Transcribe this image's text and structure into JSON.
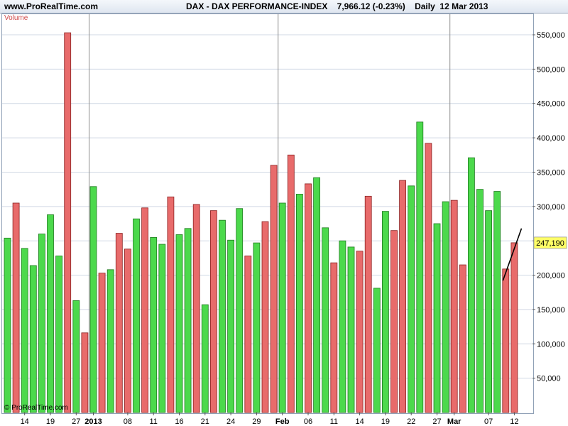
{
  "header": {
    "site": "www.ProRealTime.com",
    "title": "DAX - DAX PERFORMANCE-INDEX    7,966.12 (-0.23%)    Daily  12 Mar 2013"
  },
  "indicator_label": "Volume",
  "copyright": "© ProRealTime.com",
  "current_value_label": "247,190",
  "colors": {
    "up": "#4cd94c",
    "down": "#e86b6b",
    "up_stroke": "#1f7a1f",
    "down_stroke": "#8a2020",
    "grid": "#d0d8e4",
    "axis_bg": "#ffffff",
    "marker_bg": "#ffff66"
  },
  "chart_data": {
    "type": "bar",
    "title": "DAX - DAX PERFORMANCE-INDEX",
    "ylim": [
      0,
      580000
    ],
    "y_ticks": [
      {
        "value": 50000,
        "label": "50,000"
      },
      {
        "value": 100000,
        "label": "100,000"
      },
      {
        "value": 150000,
        "label": "150,000"
      },
      {
        "value": 200000,
        "label": "200,000"
      },
      {
        "value": 250000,
        "label": "250,000"
      },
      {
        "value": 300000,
        "label": "300,000"
      },
      {
        "value": 350000,
        "label": "350,000"
      },
      {
        "value": 400000,
        "label": "400,000"
      },
      {
        "value": 450000,
        "label": "450,000"
      },
      {
        "value": 500000,
        "label": "500,000"
      },
      {
        "value": 550000,
        "label": "550,000"
      }
    ],
    "x_ticks": [
      {
        "index": 2,
        "label": "14",
        "bold": false
      },
      {
        "index": 5,
        "label": "19",
        "bold": false
      },
      {
        "index": 8,
        "label": "27",
        "bold": false
      },
      {
        "index": 10,
        "label": "2013",
        "bold": true,
        "separator": true
      },
      {
        "index": 14,
        "label": "08",
        "bold": false
      },
      {
        "index": 17,
        "label": "11",
        "bold": false
      },
      {
        "index": 20,
        "label": "16",
        "bold": false
      },
      {
        "index": 23,
        "label": "21",
        "bold": false
      },
      {
        "index": 26,
        "label": "24",
        "bold": false
      },
      {
        "index": 29,
        "label": "29",
        "bold": false
      },
      {
        "index": 32,
        "label": "Feb",
        "bold": true,
        "separator": true
      },
      {
        "index": 35,
        "label": "06",
        "bold": false
      },
      {
        "index": 38,
        "label": "11",
        "bold": false
      },
      {
        "index": 41,
        "label": "14",
        "bold": false
      },
      {
        "index": 44,
        "label": "19",
        "bold": false
      },
      {
        "index": 47,
        "label": "22",
        "bold": false
      },
      {
        "index": 50,
        "label": "27",
        "bold": false
      },
      {
        "index": 52,
        "label": "Mar",
        "bold": true,
        "separator": true
      },
      {
        "index": 56,
        "label": "07",
        "bold": false
      },
      {
        "index": 59,
        "label": "12",
        "bold": false
      }
    ],
    "bars": [
      {
        "v": 254000,
        "d": "up"
      },
      {
        "v": 305000,
        "d": "down"
      },
      {
        "v": 239000,
        "d": "up"
      },
      {
        "v": 214000,
        "d": "up"
      },
      {
        "v": 260000,
        "d": "up"
      },
      {
        "v": 288000,
        "d": "up"
      },
      {
        "v": 228000,
        "d": "up"
      },
      {
        "v": 553000,
        "d": "down"
      },
      {
        "v": 163000,
        "d": "up"
      },
      {
        "v": 116000,
        "d": "down"
      },
      {
        "v": 329000,
        "d": "up"
      },
      {
        "v": 203000,
        "d": "down"
      },
      {
        "v": 208000,
        "d": "up"
      },
      {
        "v": 261000,
        "d": "down"
      },
      {
        "v": 238000,
        "d": "down"
      },
      {
        "v": 282000,
        "d": "up"
      },
      {
        "v": 298000,
        "d": "down"
      },
      {
        "v": 255000,
        "d": "up"
      },
      {
        "v": 245000,
        "d": "up"
      },
      {
        "v": 314000,
        "d": "down"
      },
      {
        "v": 259000,
        "d": "up"
      },
      {
        "v": 268000,
        "d": "up"
      },
      {
        "v": 303000,
        "d": "down"
      },
      {
        "v": 157000,
        "d": "up"
      },
      {
        "v": 294000,
        "d": "down"
      },
      {
        "v": 280000,
        "d": "up"
      },
      {
        "v": 251000,
        "d": "up"
      },
      {
        "v": 297000,
        "d": "up"
      },
      {
        "v": 228000,
        "d": "down"
      },
      {
        "v": 247000,
        "d": "up"
      },
      {
        "v": 278000,
        "d": "down"
      },
      {
        "v": 360000,
        "d": "down"
      },
      {
        "v": 305000,
        "d": "up"
      },
      {
        "v": 375000,
        "d": "down"
      },
      {
        "v": 318000,
        "d": "up"
      },
      {
        "v": 333000,
        "d": "down"
      },
      {
        "v": 342000,
        "d": "up"
      },
      {
        "v": 269000,
        "d": "up"
      },
      {
        "v": 218000,
        "d": "down"
      },
      {
        "v": 250000,
        "d": "up"
      },
      {
        "v": 241000,
        "d": "up"
      },
      {
        "v": 235000,
        "d": "down"
      },
      {
        "v": 315000,
        "d": "down"
      },
      {
        "v": 181000,
        "d": "up"
      },
      {
        "v": 293000,
        "d": "up"
      },
      {
        "v": 265000,
        "d": "down"
      },
      {
        "v": 338000,
        "d": "down"
      },
      {
        "v": 330000,
        "d": "up"
      },
      {
        "v": 423000,
        "d": "up"
      },
      {
        "v": 392000,
        "d": "down"
      },
      {
        "v": 275000,
        "d": "up"
      },
      {
        "v": 307000,
        "d": "up"
      },
      {
        "v": 309000,
        "d": "down"
      },
      {
        "v": 215000,
        "d": "down"
      },
      {
        "v": 371000,
        "d": "up"
      },
      {
        "v": 325000,
        "d": "up"
      },
      {
        "v": 294000,
        "d": "up"
      },
      {
        "v": 322000,
        "d": "up"
      },
      {
        "v": 209000,
        "d": "down"
      },
      {
        "v": 247190,
        "d": "down"
      }
    ],
    "trend_line": {
      "from_index": 58,
      "to_index": 60,
      "from_value": 192000,
      "to_value": 268000
    }
  }
}
